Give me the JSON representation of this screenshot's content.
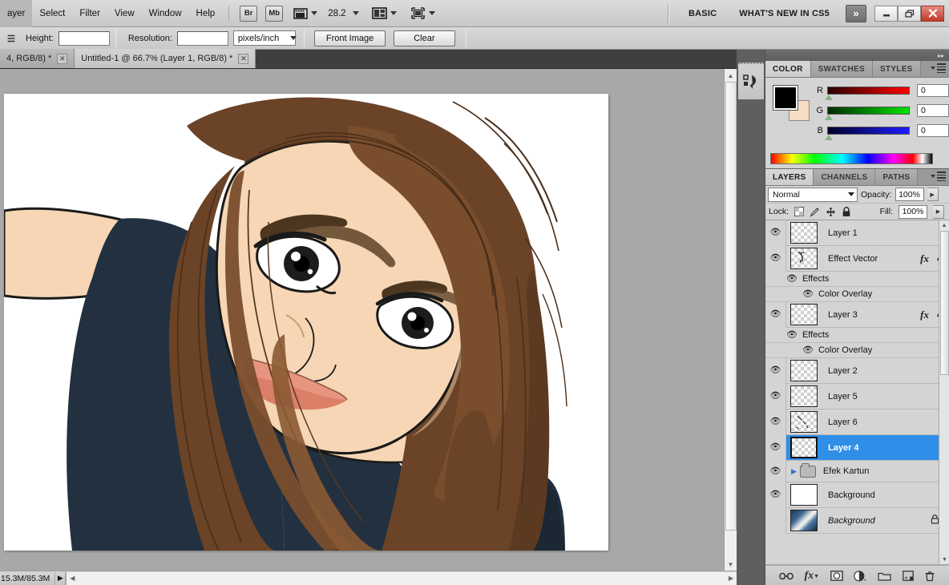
{
  "menubar": {
    "items": [
      "ayer",
      "Select",
      "Filter",
      "View",
      "Window",
      "Help"
    ],
    "bridge_label": "Br",
    "minibridge_label": "Mb",
    "zoom_value": "28.2",
    "workspace_basic": "BASIC",
    "workspace_whatsnew": "WHAT'S NEW IN CS5",
    "chevron_label": "»",
    "window_buttons": {
      "minimize": "—",
      "restore": "❐",
      "close": "✕"
    },
    "icon_names": [
      "screen-mode-icon",
      "arrange-documents-icon",
      "view-extras-icon"
    ]
  },
  "options_bar": {
    "height_label": "Height:",
    "height_value": "",
    "resolution_label": "Resolution:",
    "resolution_value": "",
    "units_value": "pixels/inch",
    "front_image_label": "Front Image",
    "clear_label": "Clear"
  },
  "tabs": [
    {
      "title": "4, RGB/8) *",
      "active": false,
      "close": "✕"
    },
    {
      "title": "Untitled-1 @ 66.7% (Layer 1, RGB/8) *",
      "active": true,
      "close": "✕"
    }
  ],
  "status_bar": {
    "doc_sizes": "15.3M/85.3M",
    "expand_arrow": "▶"
  },
  "color_panel": {
    "tabs": [
      "COLOR",
      "SWATCHES",
      "STYLES"
    ],
    "active_tab": "COLOR",
    "foreground_hex": "#000000",
    "background_hex": "#f6dcc0",
    "channels": [
      {
        "label": "R",
        "value": "0",
        "track_from": "#2a0000",
        "track_to": "#ff0000"
      },
      {
        "label": "G",
        "value": "0",
        "track_from": "#002a00",
        "track_to": "#00e400"
      },
      {
        "label": "B",
        "value": "0",
        "track_from": "#00002a",
        "track_to": "#1d1dff"
      }
    ]
  },
  "layers_panel": {
    "tabs": [
      "LAYERS",
      "CHANNELS",
      "PATHS"
    ],
    "active_tab": "LAYERS",
    "blend_mode": "Normal",
    "opacity_label": "Opacity:",
    "opacity_value": "100%",
    "lock_label": "Lock:",
    "fill_label": "Fill:",
    "fill_value": "100%",
    "lock_icons": [
      "lock-transparency-icon",
      "lock-image-icon",
      "lock-position-icon",
      "lock-all-icon"
    ],
    "rows": [
      {
        "kind": "layer",
        "name": "Layer 1",
        "visible": true,
        "thumb": "checker",
        "fx": false,
        "selected": false,
        "italic": false,
        "locked": false
      },
      {
        "kind": "layer",
        "name": "Effect Vector",
        "visible": true,
        "thumb": "checker-art",
        "fx": true,
        "selected": false,
        "italic": false,
        "locked": false
      },
      {
        "kind": "effects",
        "name": "Effects",
        "visible": true,
        "indent": 1
      },
      {
        "kind": "effect",
        "name": "Color Overlay",
        "visible": true,
        "indent": 2
      },
      {
        "kind": "layer",
        "name": "Layer 3",
        "visible": true,
        "thumb": "checker",
        "fx": true,
        "selected": false,
        "italic": false,
        "locked": false
      },
      {
        "kind": "effects",
        "name": "Effects",
        "visible": true,
        "indent": 1
      },
      {
        "kind": "effect",
        "name": "Color Overlay",
        "visible": true,
        "indent": 2
      },
      {
        "kind": "layer",
        "name": "Layer 2",
        "visible": true,
        "thumb": "checker",
        "fx": false,
        "selected": false,
        "italic": false,
        "locked": false
      },
      {
        "kind": "layer",
        "name": "Layer 5",
        "visible": true,
        "thumb": "checker",
        "fx": false,
        "selected": false,
        "italic": false,
        "locked": false
      },
      {
        "kind": "layer",
        "name": "Layer 6",
        "visible": true,
        "thumb": "checker-art",
        "fx": false,
        "selected": false,
        "italic": false,
        "locked": false
      },
      {
        "kind": "layer",
        "name": "Layer 4",
        "visible": true,
        "thumb": "checker",
        "fx": false,
        "selected": true,
        "italic": false,
        "locked": false
      },
      {
        "kind": "group",
        "name": "Efek Kartun",
        "visible": true,
        "expanded": false
      },
      {
        "kind": "layer",
        "name": "Background",
        "visible": true,
        "thumb": "white",
        "fx": false,
        "selected": false,
        "italic": false,
        "locked": false
      },
      {
        "kind": "layer",
        "name": "Background",
        "visible": false,
        "thumb": "photo",
        "fx": false,
        "selected": false,
        "italic": true,
        "locked": true
      }
    ],
    "footer_buttons": [
      "link-layers-icon",
      "add-layer-style-icon",
      "add-layer-mask-icon",
      "new-adjustment-layer-icon",
      "new-group-icon",
      "new-layer-icon",
      "delete-layer-icon"
    ]
  },
  "dock": {
    "collapse_left": "◂◂",
    "collapse_right": "▸▸",
    "icon_name": "history-actions-icon"
  },
  "canvas": {
    "title": "cartoon-portrait-illustration",
    "description": "Vector cartoon illustration of a young woman with long brown hair wearing a dark navy top, outstretched arm at left",
    "colors": {
      "skin": "#f6d6b4",
      "hair_dark": "#6b4327",
      "hair_mid": "#8a5a33",
      "shirt": "#22303f",
      "lips": "#e8957f",
      "outline": "#1a1a1a",
      "background": "#ffffff"
    }
  }
}
